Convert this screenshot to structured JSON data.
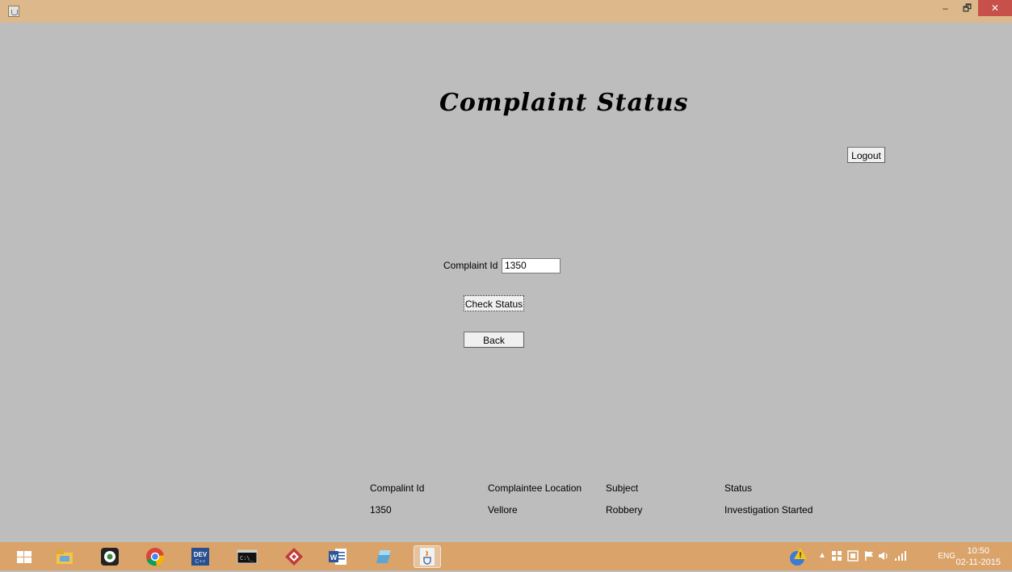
{
  "window": {
    "minimize": "–",
    "restore": "🗗",
    "close": "✕"
  },
  "page": {
    "title": "Complaint Status"
  },
  "logout_label": "Logout",
  "form": {
    "id_label": "Complaint Id",
    "id_value": "1350",
    "check_label": "Check Status",
    "back_label": "Back"
  },
  "results": {
    "headers": [
      "Compalint Id",
      "Complaintee Location",
      "Subject",
      "Status"
    ],
    "row": [
      "1350",
      "Vellore",
      "Robbery",
      "Investigation Started"
    ]
  },
  "taskbar": {
    "apps": [
      "start-icon",
      "file-explorer-icon",
      "camera-app-icon",
      "chrome-icon",
      "dev-cpp-icon",
      "command-prompt-icon",
      "app-icon",
      "word-icon",
      "app-icon",
      "java-icon"
    ],
    "language": "ENG",
    "time": "10:50",
    "date": "02-11-2015"
  }
}
